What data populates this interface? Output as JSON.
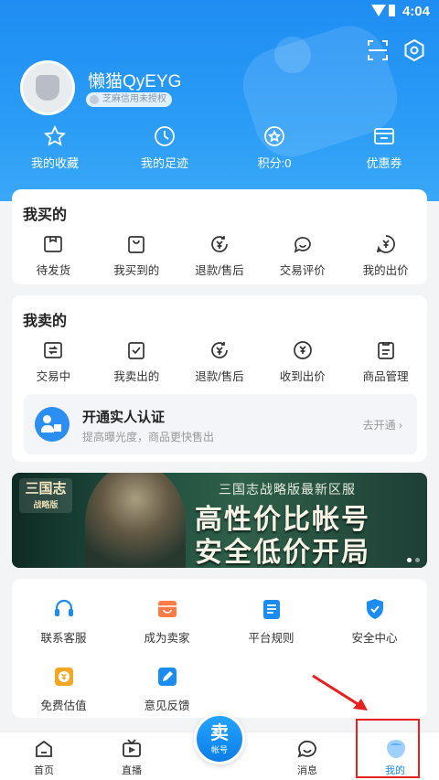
{
  "status": {
    "time": "4:04"
  },
  "profile": {
    "username": "懒猫QyEYG",
    "auth_badge": "芝麻信用未授权"
  },
  "quick": [
    {
      "label": "我的收藏",
      "icon": "star-icon"
    },
    {
      "label": "我的足迹",
      "icon": "clock-icon"
    },
    {
      "label": "积分:0",
      "icon": "points-icon"
    },
    {
      "label": "优惠券",
      "icon": "coupon-icon"
    }
  ],
  "buy": {
    "title": "我买的",
    "items": [
      {
        "label": "待发货",
        "icon": "box-icon"
      },
      {
        "label": "我买到的",
        "icon": "bag-icon"
      },
      {
        "label": "退款/售后",
        "icon": "refund-icon"
      },
      {
        "label": "交易评价",
        "icon": "comment-icon"
      },
      {
        "label": "我的出价",
        "icon": "bid-icon"
      }
    ]
  },
  "sell": {
    "title": "我卖的",
    "items": [
      {
        "label": "交易中",
        "icon": "transaction-icon"
      },
      {
        "label": "我卖出的",
        "icon": "sold-icon"
      },
      {
        "label": "退款/售后",
        "icon": "refund-icon"
      },
      {
        "label": "收到出价",
        "icon": "received-bid-icon"
      },
      {
        "label": "商品管理",
        "icon": "goods-manage-icon"
      }
    ],
    "verify": {
      "title": "开通实人认证",
      "subtitle": "提高曝光度，商品更快售出",
      "link": "去开通"
    }
  },
  "banner": {
    "logo_title": "三国志",
    "logo_sub": "战略版",
    "line1": "三国志战略版最新区服",
    "line2": "高性价比帐号",
    "line3": "安全低价开局"
  },
  "services": [
    {
      "label": "联系客服",
      "icon": "headset-icon"
    },
    {
      "label": "成为卖家",
      "icon": "shop-icon"
    },
    {
      "label": "平台规则",
      "icon": "rules-icon"
    },
    {
      "label": "安全中心",
      "icon": "shield-icon"
    },
    {
      "label": "免费估值",
      "icon": "valuation-icon"
    },
    {
      "label": "意见反馈",
      "icon": "feedback-icon"
    }
  ],
  "tabs": [
    {
      "label": "首页",
      "icon": "home-icon"
    },
    {
      "label": "直播",
      "icon": "tv-icon"
    },
    {
      "label": "消息",
      "icon": "message-icon"
    },
    {
      "label": "我的",
      "icon": "profile-icon"
    }
  ],
  "sell_button": {
    "big": "卖",
    "small": "帐号"
  },
  "colors": {
    "primary": "#1a8cf2",
    "highlight": "#e8201e",
    "background": "#f3f4f6"
  }
}
